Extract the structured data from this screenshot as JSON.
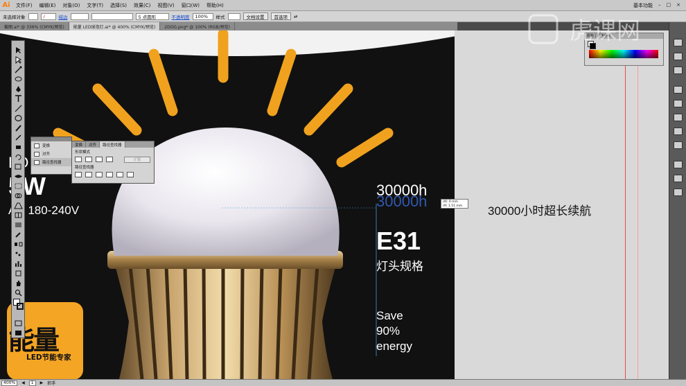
{
  "app": {
    "logo": "Ai",
    "workspace": "基本功能"
  },
  "menu": [
    "文件(F)",
    "编辑(E)",
    "对象(O)",
    "文字(T)",
    "选择(S)",
    "效果(C)",
    "视图(V)",
    "窗口(W)",
    "帮助(H)"
  ],
  "control_bar": {
    "selection_label": "未选择对象",
    "stroke_label": "描边",
    "brush_value": "5 点圆形",
    "opacity_label": "不透明度",
    "opacity_value": "100%",
    "style_label": "样式",
    "doc_setup_button": "文档设置",
    "prefs_button": "首选项"
  },
  "tabs": [
    {
      "label": "截图.ai* @ 336% (CMYK/预览)",
      "active": false
    },
    {
      "label": "能量 LED球泡灯.ai* @ 400% (CMYK/预览)",
      "active": true
    },
    {
      "label": "2DOG.png* @ 100% (RGB/预览)",
      "active": false
    }
  ],
  "artwork": {
    "left_text_1": "LO",
    "left_text_2": "5W",
    "voltage": "AC 180-240V",
    "hours_main": "30000h",
    "hours_dup": "30000h",
    "socket_code": "E31",
    "socket_desc": "灯头规格",
    "save_line1": "Save",
    "save_line2": "90%",
    "save_line3": "energy",
    "badge_main": "能量",
    "badge_sub": "LED节能专家",
    "tooltip_line1": "dX: 0 mm",
    "tooltip_line2": "dY: 1.51 mm",
    "pasteboard_text": "30000小时超长续航"
  },
  "pathfinder_panel": {
    "tabs": [
      "变换",
      "对齐",
      "路径查找器"
    ],
    "shape_modes_label": "形状模式",
    "expand_button": "扩展",
    "pathfinders_label": "路径查找器"
  },
  "align_panel": {
    "items": [
      "变换",
      "对齐",
      "路径查找器"
    ],
    "selected": 2
  },
  "color_panel": {
    "header": "颜色 | 颜色参考"
  },
  "status_bar": {
    "zoom": "400%",
    "page": "1",
    "tool_name": "抓手"
  },
  "watermark": {
    "text": "虎课网"
  },
  "colors": {
    "accent": "#f5a524",
    "canvas": "#111111",
    "pasteboard": "#d9d9d9",
    "selection": "#3b6fe0"
  }
}
